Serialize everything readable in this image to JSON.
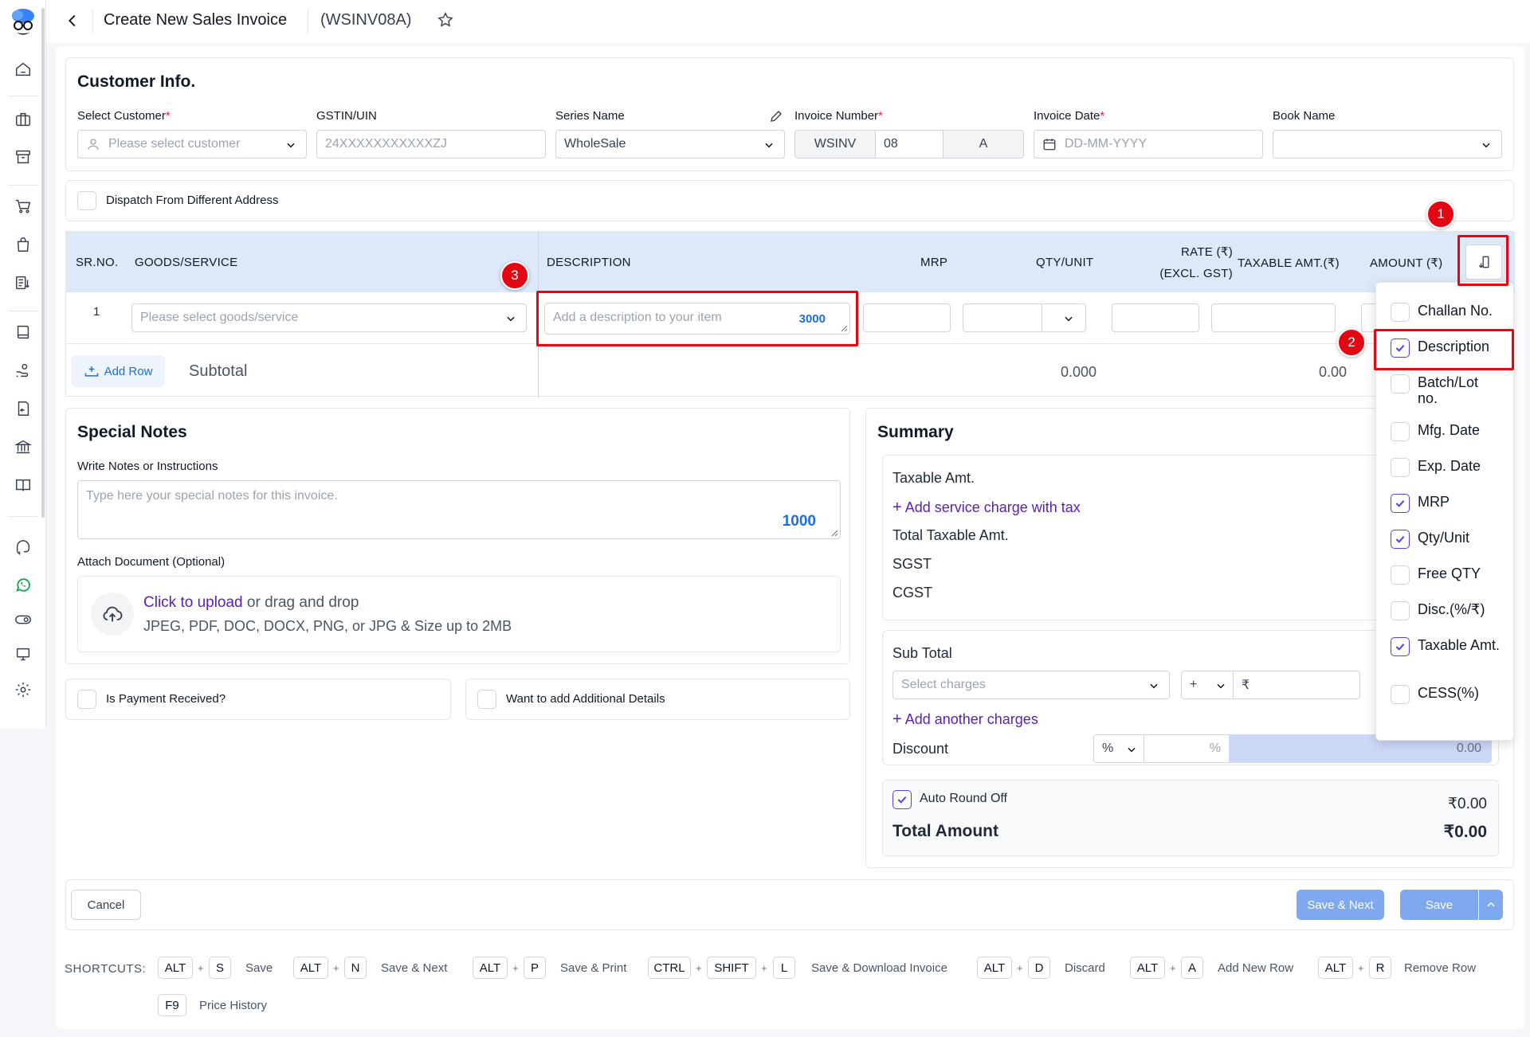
{
  "header": {
    "title": "Create New Sales Invoice",
    "code": "(WSINV08A)"
  },
  "customer_info": {
    "heading": "Customer Info.",
    "select_customer_label": "Select Customer",
    "select_customer_placeholder": "Please select customer",
    "gstin_label": "GSTIN/UIN",
    "gstin_placeholder": "24XXXXXXXXXXXZJ",
    "series_label": "Series Name",
    "series_value": "WholeSale",
    "invoice_number_label": "Invoice Number",
    "invoice_prefix": "WSINV",
    "invoice_number": "08",
    "invoice_suffix": "A",
    "invoice_date_label": "Invoice Date",
    "invoice_date_placeholder": "DD-MM-YYYY",
    "book_name_label": "Book Name",
    "book_name_value": ""
  },
  "dispatch": {
    "label": "Dispatch From Different Address"
  },
  "items_table": {
    "headers": {
      "sr": "SR.NO.",
      "goods": "GOODS/SERVICE",
      "description": "DESCRIPTION",
      "mrp": "MRP",
      "qty": "QTY/UNIT",
      "rate_line1": "RATE (₹)",
      "rate_line2": "(EXCL. GST)",
      "taxable": "TAXABLE AMT.(₹)",
      "amount": "AMOUNT (₹)"
    },
    "row": {
      "sr": "1",
      "goods_placeholder": "Please select goods/service",
      "description_placeholder": "Add a description to your item",
      "description_counter": "3000"
    },
    "add_row": "Add Row",
    "subtotal_label": "Subtotal",
    "subtotal_qty": "0.000",
    "subtotal_taxable": "0.00"
  },
  "column_menu": {
    "items": [
      {
        "label": "Challan No.",
        "checked": false
      },
      {
        "label": "Description",
        "checked": true
      },
      {
        "label": "Batch/Lot no.",
        "checked": false
      },
      {
        "label": "Mfg. Date",
        "checked": false
      },
      {
        "label": "Exp. Date",
        "checked": false
      },
      {
        "label": "MRP",
        "checked": true
      },
      {
        "label": "Qty/Unit",
        "checked": true
      },
      {
        "label": "Free QTY",
        "checked": false
      },
      {
        "label": "Disc.(%/₹)",
        "checked": false
      },
      {
        "label": "Taxable Amt.",
        "checked": true
      },
      {
        "label": "CESS(%)",
        "checked": false
      }
    ]
  },
  "annotations": {
    "one": "1",
    "two": "2",
    "three": "3"
  },
  "special_notes": {
    "heading": "Special Notes",
    "notes_label": "Write Notes or Instructions",
    "notes_placeholder": "Type here your special notes for this invoice.",
    "notes_counter": "1000",
    "attach_label": "Attach Document (Optional)",
    "upload_link": "Click to upload",
    "upload_rest": "or drag and drop",
    "upload_hint": "JPEG, PDF, DOC, DOCX, PNG, or JPG & Size up to 2MB"
  },
  "payment": {
    "label": "Is Payment Received?"
  },
  "additional": {
    "label": "Want to add Additional Details"
  },
  "summary": {
    "heading": "Summary",
    "taxable_amt": "Taxable Amt.",
    "add_service_charge": "Add service charge with tax",
    "total_taxable": "Total Taxable Amt.",
    "sgst": "SGST",
    "cgst": "CGST",
    "sub_total": "Sub Total",
    "select_charges_placeholder": "Select charges",
    "charge_sign": "+",
    "rupee": "₹",
    "add_another_charges": "Add another charges",
    "discount_label": "Discount",
    "discount_type": "%",
    "discount_pct_symbol": "%",
    "discount_value": "0.00",
    "auto_round_off": "Auto Round Off",
    "round_off_value": "₹0.00",
    "total_amount_label": "Total Amount",
    "total_amount_value": "₹0.00"
  },
  "footer": {
    "cancel": "Cancel",
    "save_next": "Save & Next",
    "save": "Save"
  },
  "shortcuts": {
    "title": "SHORTCUTS:",
    "items": [
      {
        "keys": [
          "ALT",
          "S"
        ],
        "label": "Save"
      },
      {
        "keys": [
          "ALT",
          "N"
        ],
        "label": "Save & Next"
      },
      {
        "keys": [
          "ALT",
          "P"
        ],
        "label": "Save & Print"
      },
      {
        "keys": [
          "CTRL",
          "SHIFT",
          "L"
        ],
        "label": "Save & Download Invoice"
      },
      {
        "keys": [
          "ALT",
          "D"
        ],
        "label": "Discard"
      },
      {
        "keys": [
          "ALT",
          "A"
        ],
        "label": "Add New Row"
      },
      {
        "keys": [
          "ALT",
          "R"
        ],
        "label": "Remove Row"
      },
      {
        "keys": [
          "F9"
        ],
        "label": "Price History"
      }
    ]
  },
  "colors": {
    "accent": "#5b21b6",
    "link_blue": "#1d6fd8",
    "table_header_bg": "#dde8f8",
    "save_button": "#7ea9ef",
    "annotation_red": "#e30613"
  }
}
